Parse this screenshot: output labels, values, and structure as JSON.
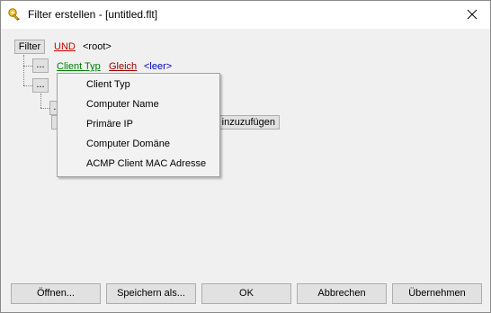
{
  "window": {
    "title": "Filter erstellen - [untitled.flt]"
  },
  "tree": {
    "filter_button": "Filter",
    "root_operator": "UND",
    "root_label": "<root>",
    "row1": {
      "ellipsis": "...",
      "field": "Client Typ",
      "operator": "Gleich",
      "value": "<leer>"
    },
    "row2": {
      "ellipsis": "..."
    },
    "row3": {
      "ellipsis": "...",
      "add_button_visible_text": "inzuzufügen"
    }
  },
  "context_menu": {
    "items": [
      "Client Typ",
      "Computer Name",
      "Primäre IP",
      "Computer Domäne",
      "ACMP Client MAC Adresse"
    ]
  },
  "footer": {
    "open": "Öffnen...",
    "save_as": "Speichern als...",
    "ok": "OK",
    "cancel": "Abbrechen",
    "apply": "Übernehmen"
  }
}
